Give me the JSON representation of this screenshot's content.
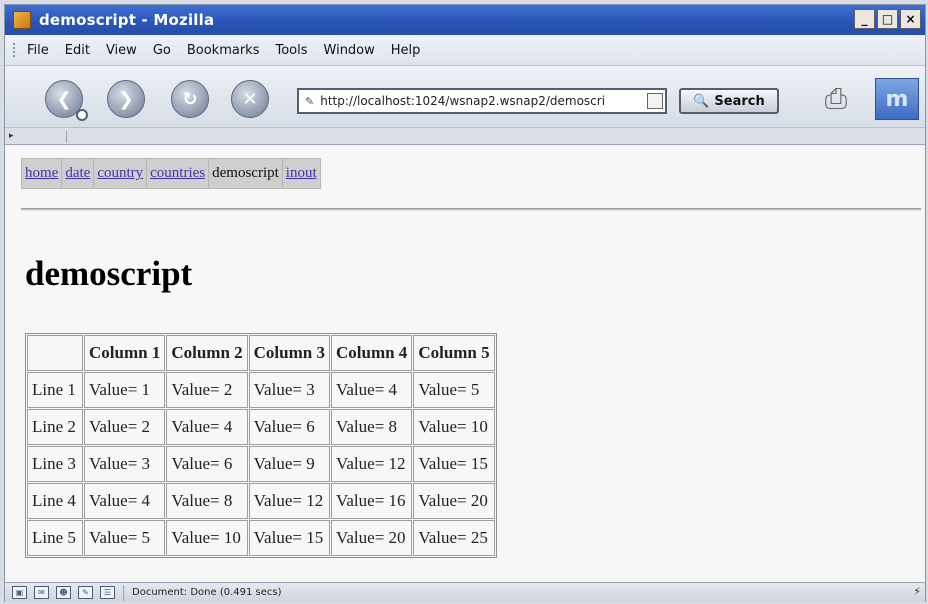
{
  "window": {
    "title": "demoscript - Mozilla",
    "controls": [
      "_",
      "□",
      "×"
    ]
  },
  "menu": [
    "File",
    "Edit",
    "View",
    "Go",
    "Bookmarks",
    "Tools",
    "Window",
    "Help"
  ],
  "toolbar": {
    "back_icon": "back-arrow",
    "forward_icon": "forward-arrow",
    "reload_icon": "reload",
    "stop_icon": "stop",
    "url": "http://localhost:1024/wsnap2.wsnap2/demoscri",
    "search_label": "Search"
  },
  "nav": {
    "links": [
      "home",
      "date",
      "country",
      "countries",
      "demoscript",
      "inout"
    ],
    "current": "demoscript"
  },
  "page": {
    "heading": "demoscript"
  },
  "table": {
    "headers": [
      "",
      "Column 1",
      "Column 2",
      "Column 3",
      "Column 4",
      "Column 5"
    ],
    "rows": [
      [
        "Line 1",
        "Value= 1",
        "Value= 2",
        "Value= 3",
        "Value= 4",
        "Value= 5"
      ],
      [
        "Line 2",
        "Value= 2",
        "Value= 4",
        "Value= 6",
        "Value= 8",
        "Value= 10"
      ],
      [
        "Line 3",
        "Value= 3",
        "Value= 6",
        "Value= 9",
        "Value= 12",
        "Value= 15"
      ],
      [
        "Line 4",
        "Value= 4",
        "Value= 8",
        "Value= 12",
        "Value= 16",
        "Value= 20"
      ],
      [
        "Line 5",
        "Value= 5",
        "Value= 10",
        "Value= 15",
        "Value= 20",
        "Value= 25"
      ]
    ]
  },
  "status": {
    "text": "Document: Done (0.491 secs)"
  },
  "colors": {
    "titlebar": "#2a56b8",
    "link": "#4c2ea3",
    "nav_background": "#cfcfcf"
  }
}
